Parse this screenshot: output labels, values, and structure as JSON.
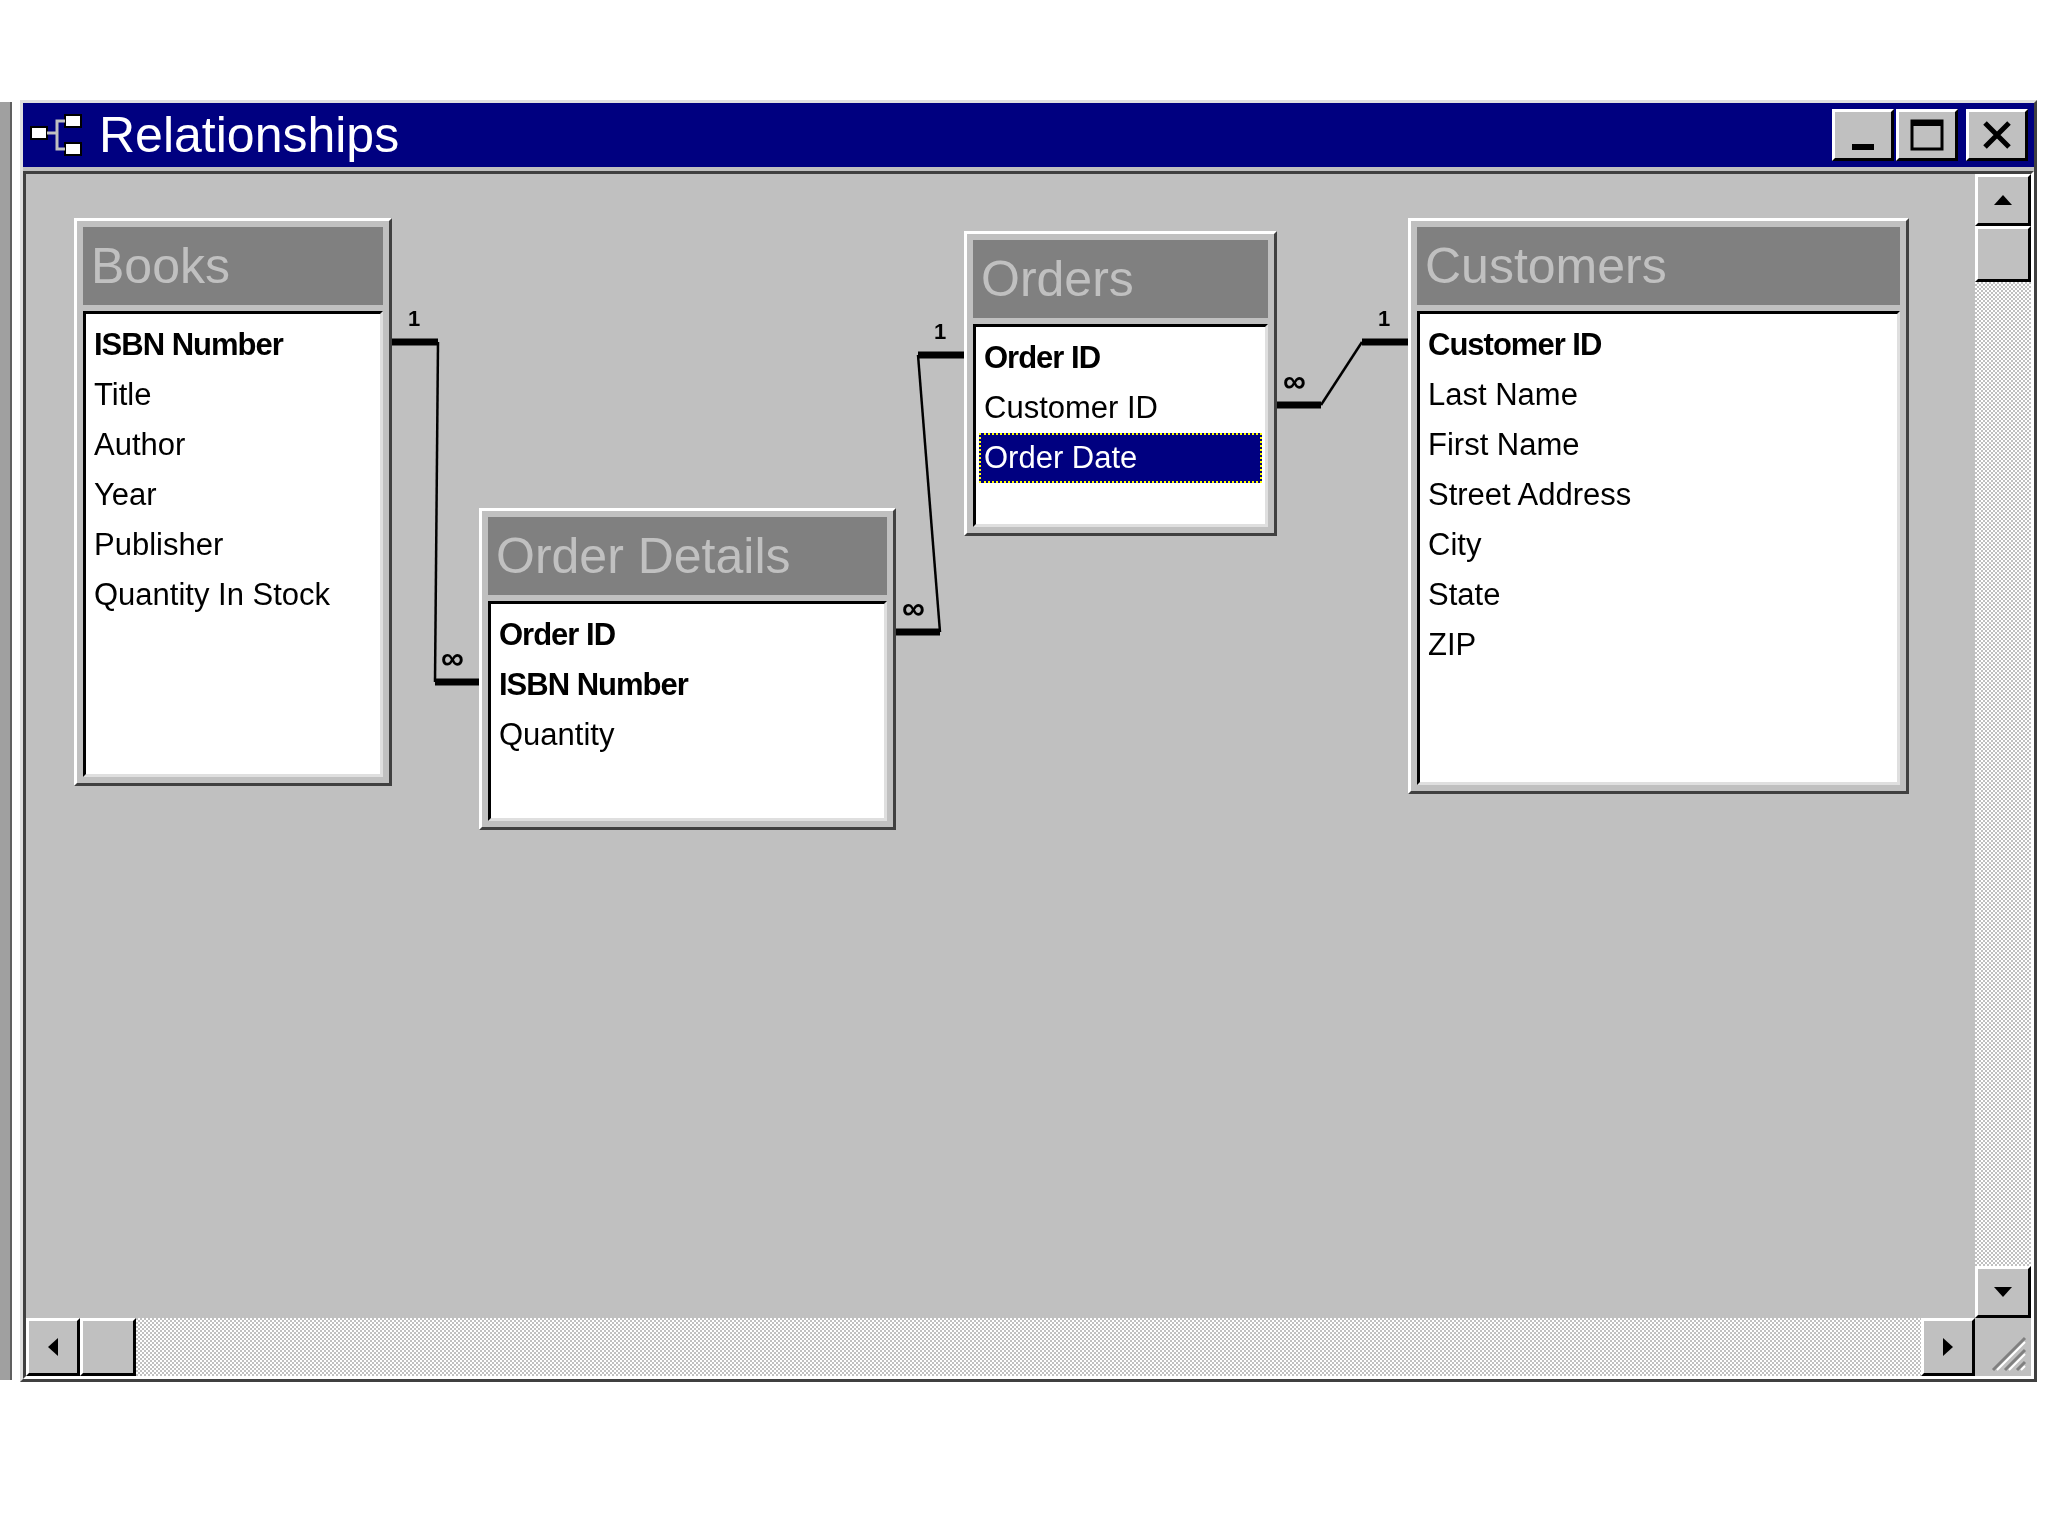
{
  "window": {
    "title": "Relationships"
  },
  "tables": [
    {
      "title": "Books",
      "fields": [
        {
          "name": "ISBN Number",
          "primary_key": true,
          "selected": false
        },
        {
          "name": "Title",
          "primary_key": false,
          "selected": false
        },
        {
          "name": "Author",
          "primary_key": false,
          "selected": false
        },
        {
          "name": "Year",
          "primary_key": false,
          "selected": false
        },
        {
          "name": "Publisher",
          "primary_key": false,
          "selected": false
        },
        {
          "name": "Quantity In Stock",
          "primary_key": false,
          "selected": false
        }
      ]
    },
    {
      "title": "Order Details",
      "fields": [
        {
          "name": "Order ID",
          "primary_key": true,
          "selected": false
        },
        {
          "name": "ISBN Number",
          "primary_key": true,
          "selected": false
        },
        {
          "name": "Quantity",
          "primary_key": false,
          "selected": false
        }
      ]
    },
    {
      "title": "Orders",
      "fields": [
        {
          "name": "Order ID",
          "primary_key": true,
          "selected": false
        },
        {
          "name": "Customer ID",
          "primary_key": false,
          "selected": false
        },
        {
          "name": "Order Date",
          "primary_key": false,
          "selected": true
        }
      ]
    },
    {
      "title": "Customers",
      "fields": [
        {
          "name": "Customer ID",
          "primary_key": true,
          "selected": false
        },
        {
          "name": "Last Name",
          "primary_key": false,
          "selected": false
        },
        {
          "name": "First Name",
          "primary_key": false,
          "selected": false
        },
        {
          "name": "Street Address",
          "primary_key": false,
          "selected": false
        },
        {
          "name": "City",
          "primary_key": false,
          "selected": false
        },
        {
          "name": "State",
          "primary_key": false,
          "selected": false
        },
        {
          "name": "ZIP",
          "primary_key": false,
          "selected": false
        }
      ]
    }
  ],
  "relationships": [
    {
      "one_label": "1",
      "many_label": "∞"
    },
    {
      "one_label": "1",
      "many_label": "∞"
    },
    {
      "one_label": "1",
      "many_label": "∞"
    }
  ]
}
